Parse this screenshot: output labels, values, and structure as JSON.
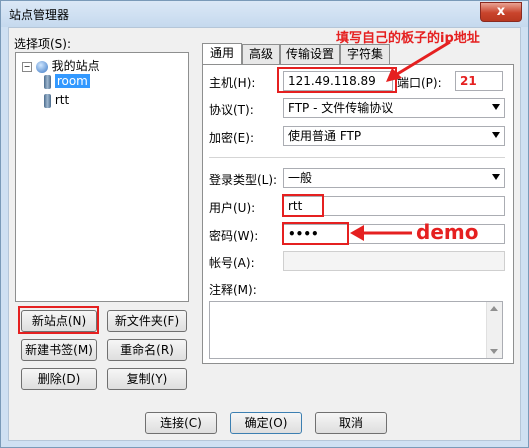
{
  "window": {
    "title": "站点管理器",
    "close_label": "x"
  },
  "left": {
    "select_label": "选择项(S):",
    "tree": {
      "root": "我的站点",
      "items": [
        "room",
        "rtt"
      ]
    },
    "buttons": {
      "new_site": "新站点(N)",
      "new_folder": "新文件夹(F)",
      "new_bookmark": "新建书签(M)",
      "rename": "重命名(R)",
      "delete": "删除(D)",
      "copy": "复制(Y)"
    }
  },
  "tabs": [
    "通用",
    "高级",
    "传输设置",
    "字符集"
  ],
  "form": {
    "host_label": "主机(H):",
    "host_value": "121.49.118.89",
    "port_label": "端口(P):",
    "port_value": "21",
    "protocol_label": "协议(T):",
    "protocol_value": "FTP - 文件传输协议",
    "encryption_label": "加密(E):",
    "encryption_value": "使用普通 FTP",
    "logon_label": "登录类型(L):",
    "logon_value": "一般",
    "user_label": "用户(U):",
    "user_value": "rtt",
    "password_label": "密码(W):",
    "password_value": "••••",
    "account_label": "帐号(A):",
    "account_value": "",
    "comments_label": "注释(M):",
    "comments_value": ""
  },
  "annotations": {
    "ip_note": "填写自己的板子的ip地址",
    "demo_note": "demo"
  },
  "footer": {
    "connect": "连接(C)",
    "ok": "确定(O)",
    "cancel": "取消"
  },
  "colors": {
    "annotation_red": "#e52020",
    "selection_blue": "#3399ff"
  }
}
